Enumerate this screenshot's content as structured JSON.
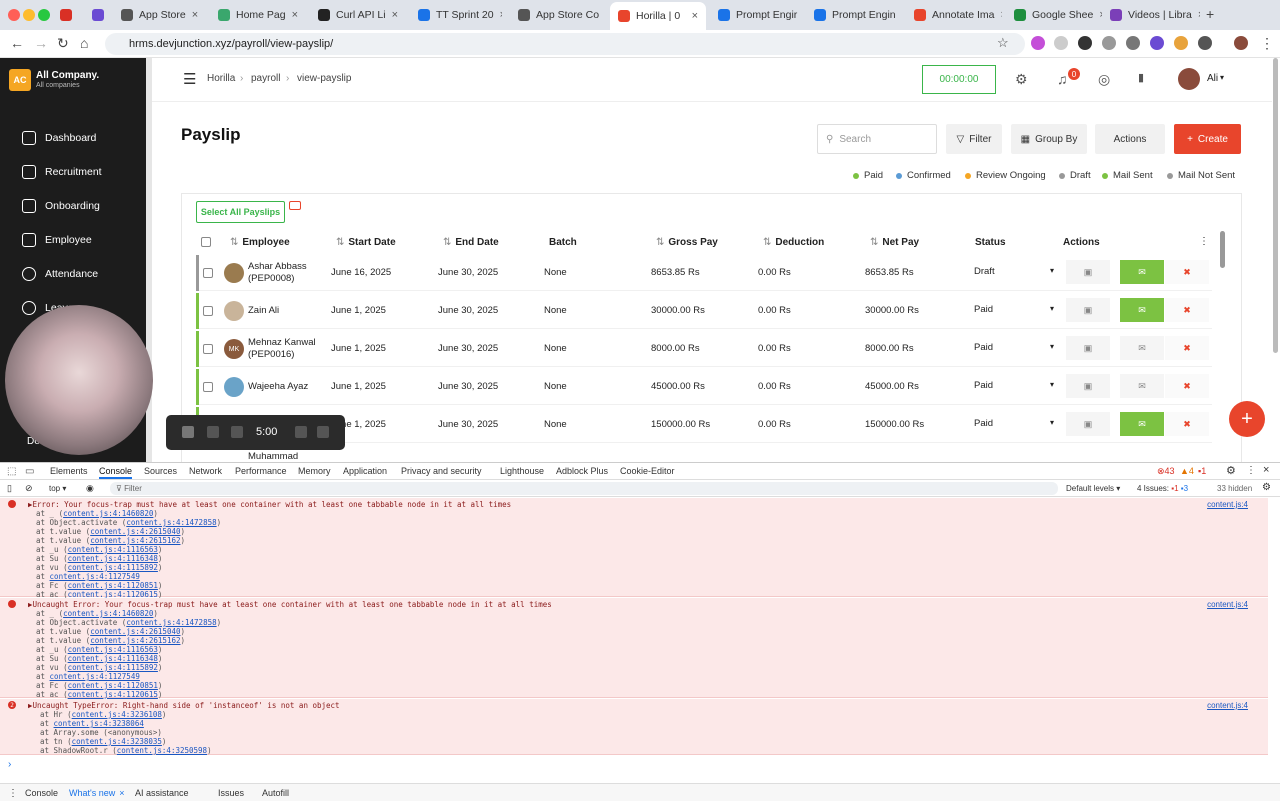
{
  "browser": {
    "tabs": [
      {
        "title": "",
        "color": "#d93025"
      },
      {
        "title": "",
        "color": "#6b4bd3"
      },
      {
        "title": "App Store",
        "color": "#555555"
      },
      {
        "title": "Home Pag",
        "color": "#3aa76d"
      },
      {
        "title": "Curl API Li",
        "color": "#222222"
      },
      {
        "title": "TT Sprint 20",
        "color": "#1a73e8"
      },
      {
        "title": "App Store Co",
        "color": "#555555"
      },
      {
        "title": "Horilla | 0",
        "color": "#e8452c"
      },
      {
        "title": "Prompt Engir",
        "color": "#1a73e8"
      },
      {
        "title": "Prompt Engin",
        "color": "#1a73e8"
      },
      {
        "title": "Annotate Ima",
        "color": "#e8452c"
      },
      {
        "title": "Google Shee",
        "color": "#1e8e3e"
      },
      {
        "title": "Videos | Libra",
        "color": "#7b3fb8"
      }
    ],
    "url": "hrms.devjunction.xyz/payroll/view-payslip/"
  },
  "sidebar": {
    "company": "All Company.",
    "company_sub": "All companies",
    "logo": "AC",
    "items": [
      "Dashboard",
      "Recruitment",
      "Onboarding",
      "Employee",
      "Attendance",
      "Leave"
    ],
    "partial": "De"
  },
  "header": {
    "breadcrumb": [
      "Horilla",
      "payroll",
      "view-payslip"
    ],
    "timer": "00:00:00",
    "notif_count": "0",
    "user": "Ali"
  },
  "page": {
    "title": "Payslip",
    "search_placeholder": "Search",
    "filter": "Filter",
    "group_by": "Group By",
    "actions": "Actions",
    "create": "Create",
    "select_all": "Select All Payslips"
  },
  "legend": [
    {
      "label": "Paid",
      "color": "#7cc242"
    },
    {
      "label": "Confirmed",
      "color": "#5b9bd5"
    },
    {
      "label": "Review Ongoing",
      "color": "#f5a623"
    },
    {
      "label": "Draft",
      "color": "#999999"
    },
    {
      "label": "Mail Sent",
      "color": "#7cc242"
    },
    {
      "label": "Mail Not Sent",
      "color": "#999999"
    }
  ],
  "table": {
    "columns": [
      "Employee",
      "Start Date",
      "End Date",
      "Batch",
      "Gross Pay",
      "Deduction",
      "Net Pay",
      "Status",
      "Actions"
    ],
    "rows": [
      {
        "name": "Ashar Abbass",
        "code": "(PEP0008)",
        "start": "June 16, 2025",
        "end": "June 30, 2025",
        "batch": "None",
        "gross": "8653.85 Rs",
        "deduction": "0.00 Rs",
        "net": "8653.85 Rs",
        "status": "Draft",
        "bar": "#999999",
        "mail": true,
        "initials": "",
        "av": "#9a7b4f"
      },
      {
        "name": "Zain Ali",
        "code": "",
        "start": "June 1, 2025",
        "end": "June 30, 2025",
        "batch": "None",
        "gross": "30000.00 Rs",
        "deduction": "0.00 Rs",
        "net": "30000.00 Rs",
        "status": "Paid",
        "bar": "#7cc242",
        "mail": true,
        "initials": "",
        "av": "#c9b49a"
      },
      {
        "name": "Mehnaz Kanwal",
        "code": "(PEP0016)",
        "start": "June 1, 2025",
        "end": "June 30, 2025",
        "batch": "None",
        "gross": "8000.00 Rs",
        "deduction": "0.00 Rs",
        "net": "8000.00 Rs",
        "status": "Paid",
        "bar": "#7cc242",
        "mail": false,
        "initials": "MK",
        "av": "#8a5a3c"
      },
      {
        "name": "Wajeeha Ayaz",
        "code": "",
        "start": "June 1, 2025",
        "end": "June 30, 2025",
        "batch": "None",
        "gross": "45000.00 Rs",
        "deduction": "0.00 Rs",
        "net": "45000.00 Rs",
        "status": "Paid",
        "bar": "#7cc242",
        "mail": false,
        "initials": "",
        "av": "#6aa3c8"
      },
      {
        "name": "",
        "code": "",
        "start": "June 1, 2025",
        "end": "June 30, 2025",
        "batch": "None",
        "gross": "150000.00 Rs",
        "deduction": "0.00 Rs",
        "net": "150000.00 Rs",
        "status": "Paid",
        "bar": "#7cc242",
        "mail": true,
        "initials": "",
        "av": "#cccccc"
      }
    ],
    "partial_name": "Muhammad"
  },
  "recorder": {
    "time": "5:00"
  },
  "devtools": {
    "tabs": [
      "Elements",
      "Console",
      "Sources",
      "Network",
      "Performance",
      "Memory",
      "Application",
      "Privacy and security",
      "Lighthouse",
      "Adblock Plus",
      "Cookie-Editor"
    ],
    "counts": {
      "errors": "43",
      "warnings": "4",
      "info": "1"
    },
    "context": "top",
    "filter_placeholder": "Filter",
    "levels": "Default levels",
    "issues_label": "4 Issues:",
    "issue_err": "1",
    "issue_info": "3",
    "hidden": "33 hidden",
    "messages": [
      {
        "head": "▶Error: Your focus-trap must have at least one container with at least one tabbable node in it at all times",
        "src": "content.js:4",
        "badge": "",
        "frames": [
          [
            "at _ (",
            "content.js:4:1460820",
            ")"
          ],
          [
            "at Object.activate (",
            "content.js:4:1472858",
            ")"
          ],
          [
            "at t.value (",
            "content.js:4:2615040",
            ")"
          ],
          [
            "at t.value (",
            "content.js:4:2615162",
            ")"
          ],
          [
            "at _u (",
            "content.js:4:1116563",
            ")"
          ],
          [
            "at Su (",
            "content.js:4:1116348",
            ")"
          ],
          [
            "at vu (",
            "content.js:4:1115892",
            ")"
          ],
          [
            "at ",
            "content.js:4:1127549",
            ""
          ],
          [
            "at Fc (",
            "content.js:4:1120851",
            ")"
          ],
          [
            "at ac (",
            "content.js:4:1120615",
            ")"
          ]
        ]
      },
      {
        "head": "▶Uncaught Error: Your focus-trap must have at least one container with at least one tabbable node in it at all times",
        "src": "content.js:4",
        "badge": "",
        "frames": [
          [
            "at _ (",
            "content.js:4:1460820",
            ")"
          ],
          [
            "at Object.activate (",
            "content.js:4:1472858",
            ")"
          ],
          [
            "at t.value (",
            "content.js:4:2615040",
            ")"
          ],
          [
            "at t.value (",
            "content.js:4:2615162",
            ")"
          ],
          [
            "at _u (",
            "content.js:4:1116563",
            ")"
          ],
          [
            "at Su (",
            "content.js:4:1116348",
            ")"
          ],
          [
            "at vu (",
            "content.js:4:1115892",
            ")"
          ],
          [
            "at ",
            "content.js:4:1127549",
            ""
          ],
          [
            "at Fc (",
            "content.js:4:1120851",
            ")"
          ],
          [
            "at ac (",
            "content.js:4:1120615",
            ")"
          ]
        ]
      },
      {
        "head": "▶Uncaught TypeError: Right-hand side of 'instanceof' is not an object",
        "src": "content.js:4",
        "badge": "2",
        "frames": [
          [
            "at Hr (",
            "content.js:4:3236108",
            ")"
          ],
          [
            "at ",
            "content.js:4:3238064",
            ""
          ],
          [
            "at Array.some (<anonymous>)",
            "",
            ""
          ],
          [
            "at tn (",
            "content.js:4:3238035",
            ")"
          ],
          [
            "at ShadowRoot.r (",
            "content.js:4:3250598",
            ")"
          ]
        ]
      }
    ],
    "drawer": [
      "Console",
      "What's new",
      "AI assistance",
      "Issues",
      "Autofill"
    ]
  },
  "icons": {
    "menu": "☰",
    "gear": "⚙",
    "bell": "♫",
    "globe": "◎",
    "sort": "⇅",
    "chev": "▾",
    "lock": "▣",
    "mail": "✉",
    "trash": "✖",
    "plus": "+",
    "search": "⚲",
    "funnel": "▽",
    "group": "▦",
    "back": "←",
    "fwd": "→",
    "reload": "↻",
    "home": "⌂",
    "star": "☆",
    "close": "×",
    "dots": "⋮"
  }
}
